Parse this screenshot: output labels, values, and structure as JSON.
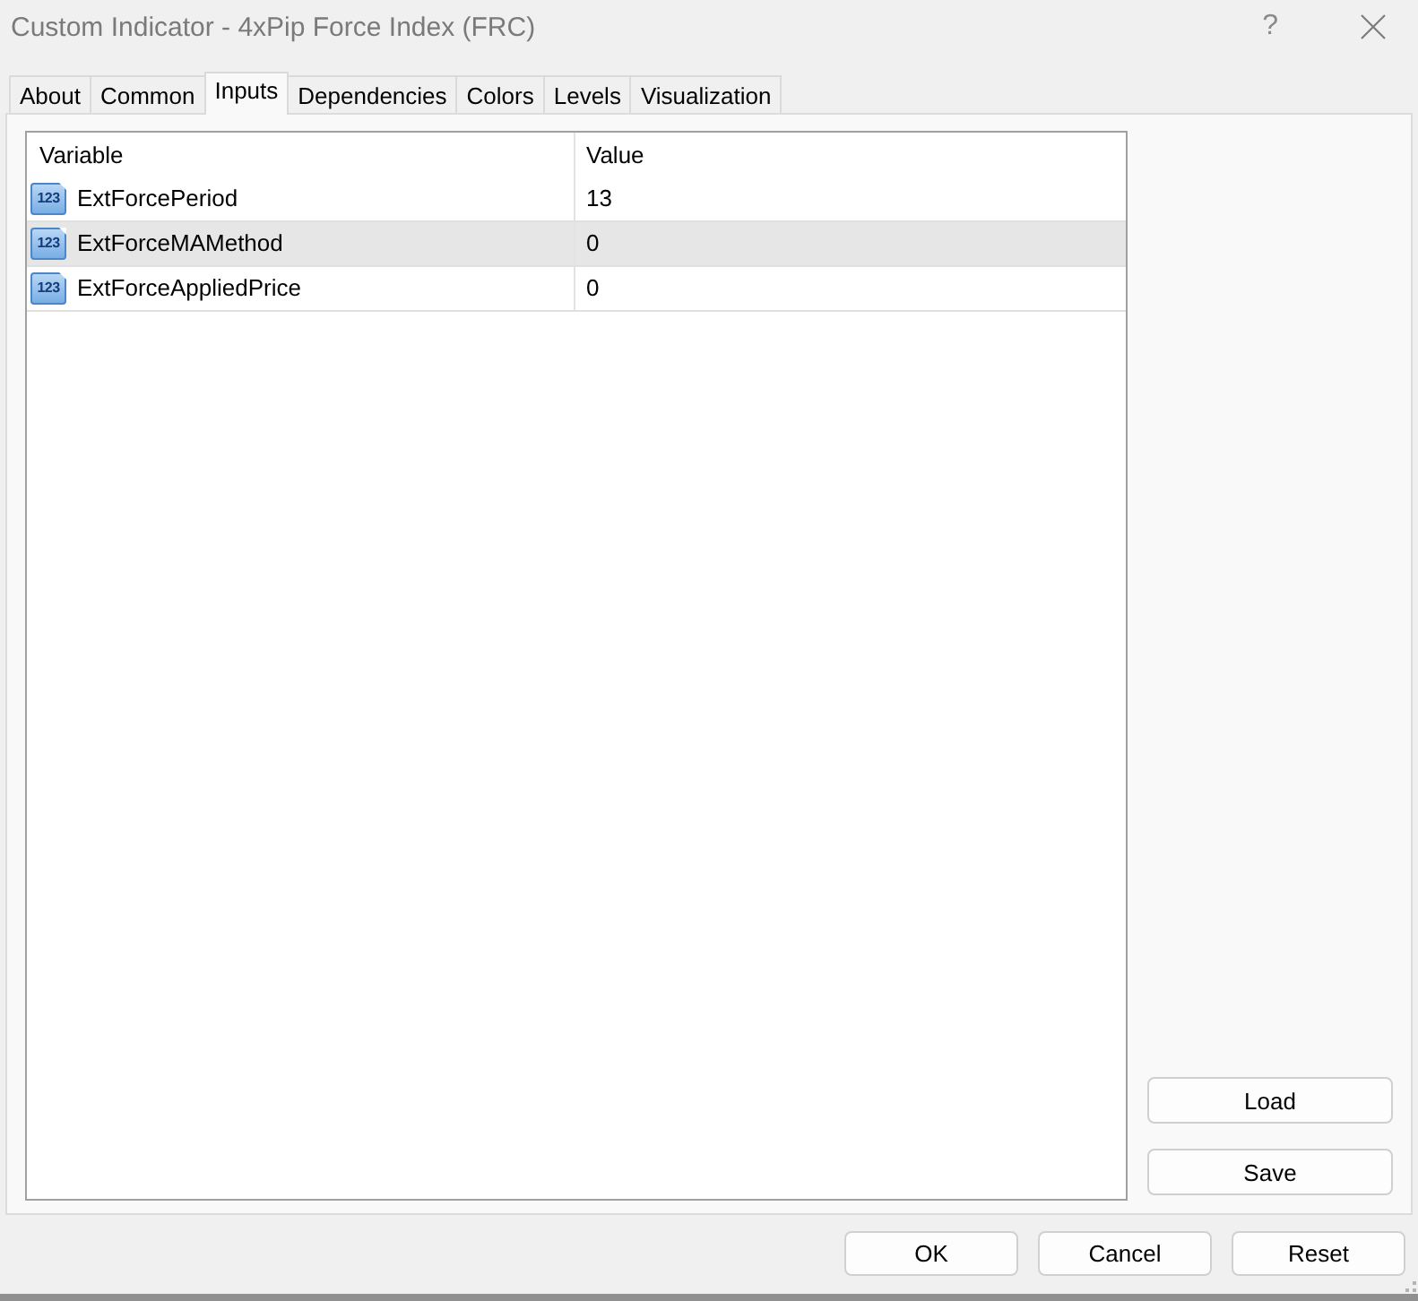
{
  "window": {
    "title": "Custom Indicator - 4xPip Force Index (FRC)",
    "help_button": "?"
  },
  "tabs": [
    {
      "label": "About",
      "selected": false
    },
    {
      "label": "Common",
      "selected": false
    },
    {
      "label": "Inputs",
      "selected": true
    },
    {
      "label": "Dependencies",
      "selected": false
    },
    {
      "label": "Colors",
      "selected": false
    },
    {
      "label": "Levels",
      "selected": false
    },
    {
      "label": "Visualization",
      "selected": false
    }
  ],
  "table": {
    "columns": [
      "Variable",
      "Value"
    ],
    "rows": [
      {
        "type_badge": "123",
        "variable": "ExtForcePeriod",
        "value": "13",
        "selected": false
      },
      {
        "type_badge": "123",
        "variable": "ExtForceMAMethod",
        "value": "0",
        "selected": true
      },
      {
        "type_badge": "123",
        "variable": "ExtForceAppliedPrice",
        "value": "0",
        "selected": false
      }
    ]
  },
  "side_buttons": [
    "Load",
    "Save"
  ],
  "buttons": [
    "OK",
    "Cancel",
    "Reset"
  ]
}
